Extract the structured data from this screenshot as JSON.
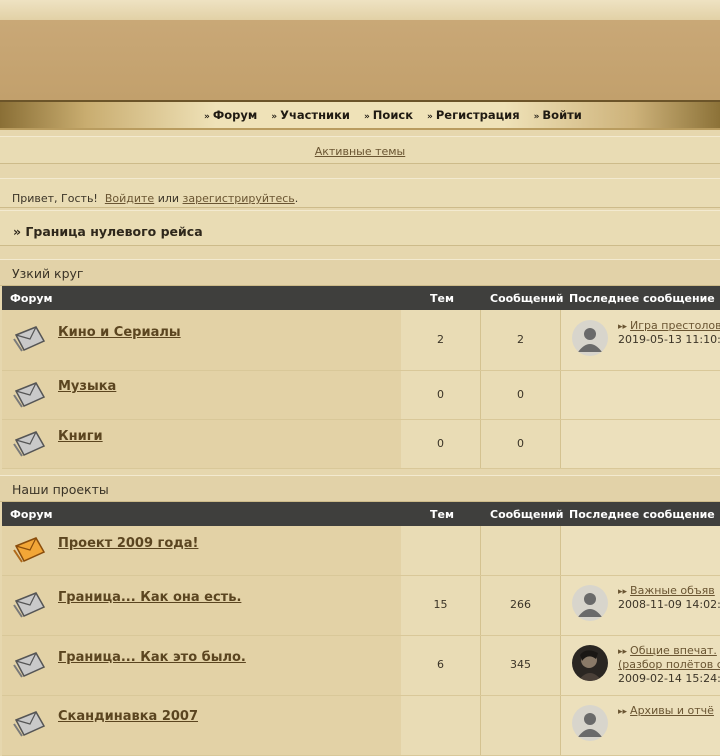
{
  "nav": {
    "items": [
      {
        "label": "Форум"
      },
      {
        "label": "Участники"
      },
      {
        "label": "Поиск"
      },
      {
        "label": "Регистрация"
      },
      {
        "label": "Войти"
      }
    ]
  },
  "active_topics": "Активные темы",
  "greeting": {
    "hello": "Привет, Гость!",
    "login": "Войдите",
    "or": "или",
    "register": "зарегистрируйтесь",
    "dot": "."
  },
  "breadcrumb": "» Граница нулевого рейса",
  "headers": {
    "forum": "Форум",
    "topics": "Тем",
    "posts": "Сообщений",
    "last": "Последнее сообщение"
  },
  "categories": [
    {
      "title": "Узкий круг",
      "forums": [
        {
          "name": "Кино и Сериалы",
          "topics": "2",
          "posts": "2",
          "last_title": "Игра престолов",
          "last_date": "2019-05-13 11:10:",
          "avatar": "default",
          "icon": "grey"
        },
        {
          "name": "Музыка",
          "topics": "0",
          "posts": "0",
          "icon": "grey"
        },
        {
          "name": "Книги",
          "topics": "0",
          "posts": "0",
          "icon": "grey"
        }
      ]
    },
    {
      "title": "Наши проекты",
      "forums": [
        {
          "name": "Проект 2009 года!",
          "topics": "",
          "posts": "",
          "icon": "orange"
        },
        {
          "name": "Граница... Как она есть.",
          "topics": "15",
          "posts": "266",
          "last_title": "Важные объяв",
          "last_date": "2008-11-09 14:02:",
          "avatar": "default",
          "icon": "grey"
        },
        {
          "name": "Граница... Как это было.",
          "topics": "6",
          "posts": "345",
          "last_title": "Общие впечат.",
          "last_title2": "(разбор полётов с",
          "last_date": "2009-02-14 15:24:",
          "avatar": "photo",
          "icon": "grey"
        },
        {
          "name": "Скандинавка 2007",
          "topics": "",
          "posts": "",
          "last_title": "Архивы и отчё",
          "avatar": "default",
          "icon": "grey"
        }
      ]
    }
  ],
  "colors": {
    "banner": "#c5a471",
    "header_bar": "#3f3f3d",
    "link": "#5b4520",
    "background": "#e6d7ae"
  },
  "icons": {
    "forum_read": "envelope-grey-icon",
    "forum_new": "envelope-orange-icon",
    "nav_arrow": "double-chevron-icon",
    "last_post": "go-to-post-icon",
    "avatar": "user-avatar-icon"
  }
}
